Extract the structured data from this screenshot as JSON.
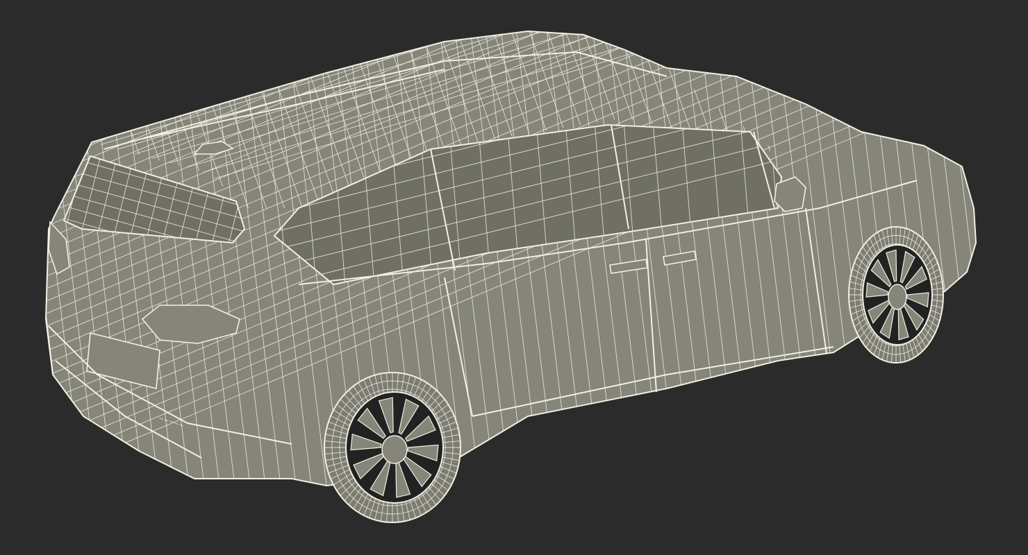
{
  "scene": {
    "subject": "minivan-wireframe-render",
    "background_color": "#2b2b2b",
    "body_fill_color": "#85857a",
    "glass_fill_color": "#6f6f64",
    "wire_color": "#f2f0e2",
    "tire_fill_color": "#7c7c72",
    "rim_dark_color": "#222222"
  }
}
